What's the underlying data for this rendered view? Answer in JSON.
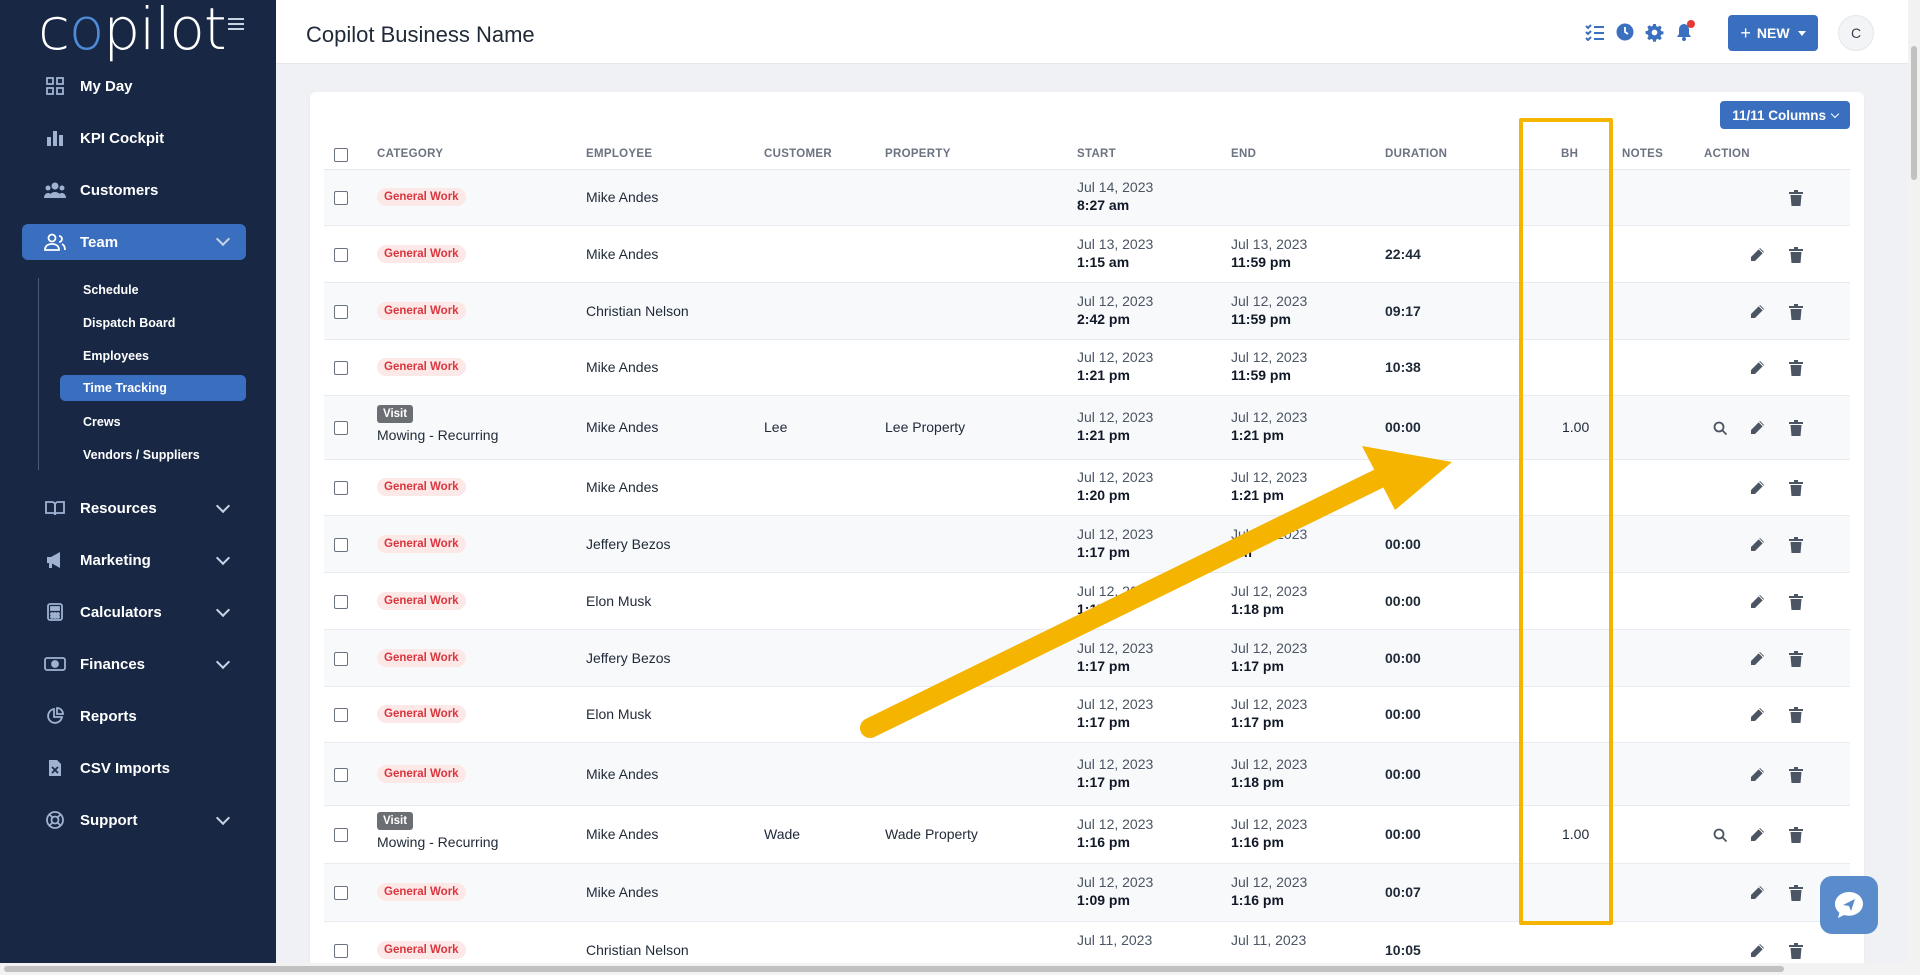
{
  "sidebar": {
    "logo": {
      "part1": "c",
      "part2": "o",
      "part3": "pilot"
    },
    "items": [
      {
        "label": "My Day",
        "icon": "grid-icon"
      },
      {
        "label": "KPI Cockpit",
        "icon": "bar-chart-icon"
      },
      {
        "label": "Customers",
        "icon": "users-icon"
      },
      {
        "label": "Team",
        "icon": "team-icon",
        "active": true
      },
      {
        "label": "Resources",
        "icon": "book-icon"
      },
      {
        "label": "Marketing",
        "icon": "megaphone-icon"
      },
      {
        "label": "Calculators",
        "icon": "calculator-icon"
      },
      {
        "label": "Finances",
        "icon": "money-icon"
      },
      {
        "label": "Reports",
        "icon": "pie-chart-icon"
      },
      {
        "label": "CSV Imports",
        "icon": "csv-file-icon"
      },
      {
        "label": "Support",
        "icon": "lifebuoy-icon"
      }
    ],
    "team_sub": [
      "Schedule",
      "Dispatch Board",
      "Employees",
      "Time Tracking",
      "Crews",
      "Vendors / Suppliers"
    ]
  },
  "header": {
    "title": "Copilot Business Name",
    "new_label": "NEW",
    "avatar_initial": "C"
  },
  "table": {
    "columns_button": "11/11 Columns",
    "headers": {
      "category": "CATEGORY",
      "employee": "EMPLOYEE",
      "customer": "CUSTOMER",
      "property": "PROPERTY",
      "start": "START",
      "end": "END",
      "duration": "DURATION",
      "bh": "BH",
      "notes": "NOTES",
      "action": "ACTION"
    },
    "rows": [
      {
        "badge": "General Work",
        "employee": "Mike Andes",
        "customer": "",
        "property": "",
        "start_date": "Jul 14, 2023",
        "start_time": "8:27 am",
        "end_date": "",
        "end_time": "",
        "duration": "",
        "bh": ""
      },
      {
        "badge": "General Work",
        "employee": "Mike Andes",
        "customer": "",
        "property": "",
        "start_date": "Jul 13, 2023",
        "start_time": "1:15 am",
        "end_date": "Jul 13, 2023",
        "end_time": "11:59 pm",
        "duration": "22:44",
        "bh": ""
      },
      {
        "badge": "General Work",
        "employee": "Christian Nelson",
        "customer": "",
        "property": "",
        "start_date": "Jul 12, 2023",
        "start_time": "2:42 pm",
        "end_date": "Jul 12, 2023",
        "end_time": "11:59 pm",
        "duration": "09:17",
        "bh": ""
      },
      {
        "badge": "General Work",
        "employee": "Mike Andes",
        "customer": "",
        "property": "",
        "start_date": "Jul 12, 2023",
        "start_time": "1:21 pm",
        "end_date": "Jul 12, 2023",
        "end_time": "11:59 pm",
        "duration": "10:38",
        "bh": ""
      },
      {
        "badge": "Visit",
        "subcategory": "Mowing - Recurring",
        "employee": "Mike Andes",
        "customer": "Lee",
        "property": "Lee Property",
        "start_date": "Jul 12, 2023",
        "start_time": "1:21 pm",
        "end_date": "Jul 12, 2023",
        "end_time": "1:21 pm",
        "duration": "00:00",
        "bh": "1.00"
      },
      {
        "badge": "General Work",
        "employee": "Mike Andes",
        "customer": "",
        "property": "",
        "start_date": "Jul 12, 2023",
        "start_time": "1:20 pm",
        "end_date": "Jul 12, 2023",
        "end_time": "1:21 pm",
        "duration": "",
        "bh": ""
      },
      {
        "badge": "General Work",
        "employee": "Jeffery Bezos",
        "customer": "",
        "property": "",
        "start_date": "Jul 12, 2023",
        "start_time": "1:17 pm",
        "end_date": "Jul 12, 2023",
        "end_time": "pm",
        "duration": "00:00",
        "bh": ""
      },
      {
        "badge": "General Work",
        "employee": "Elon Musk",
        "customer": "",
        "property": "",
        "start_date": "Jul 12, 202",
        "start_time": "1:17",
        "end_date": "Jul 12, 2023",
        "end_time": "1:18 pm",
        "duration": "00:00",
        "bh": ""
      },
      {
        "badge": "General Work",
        "employee": "Jeffery Bezos",
        "customer": "",
        "property": "",
        "start_date": "Jul 12, 2023",
        "start_time": "1:17 pm",
        "end_date": "Jul 12, 2023",
        "end_time": "1:17 pm",
        "duration": "00:00",
        "bh": ""
      },
      {
        "badge": "General Work",
        "employee": "Elon Musk",
        "customer": "",
        "property": "",
        "start_date": "Jul 12, 2023",
        "start_time": "1:17 pm",
        "end_date": "Jul 12, 2023",
        "end_time": "1:17 pm",
        "duration": "00:00",
        "bh": ""
      },
      {
        "badge": "General Work",
        "employee": "Mike Andes",
        "customer": "",
        "property": "",
        "start_date": "Jul 12, 2023",
        "start_time": "1:17 pm",
        "end_date": "Jul 12, 2023",
        "end_time": "1:18 pm",
        "duration": "00:00",
        "bh": ""
      },
      {
        "badge": "Visit",
        "subcategory": "Mowing - Recurring",
        "employee": "Mike Andes",
        "customer": "Wade",
        "property": "Wade Property",
        "start_date": "Jul 12, 2023",
        "start_time": "1:16 pm",
        "end_date": "Jul 12, 2023",
        "end_time": "1:16 pm",
        "duration": "00:00",
        "bh": "1.00"
      },
      {
        "badge": "General Work",
        "employee": "Mike Andes",
        "customer": "",
        "property": "",
        "start_date": "Jul 12, 2023",
        "start_time": "1:09 pm",
        "end_date": "Jul 12, 2023",
        "end_time": "1:16 pm",
        "duration": "00:07",
        "bh": ""
      },
      {
        "badge": "General Work",
        "employee": "Christian Nelson",
        "customer": "",
        "property": "",
        "start_date": "Jul 11, 2023",
        "start_time": "",
        "end_date": "Jul 11, 2023",
        "end_time": "",
        "duration": "10:05",
        "bh": ""
      }
    ]
  },
  "colors": {
    "sidebar_bg": "#172744",
    "accent": "#3a6fc0",
    "badge_red": "#d9363e",
    "highlight": "#f4b400"
  }
}
